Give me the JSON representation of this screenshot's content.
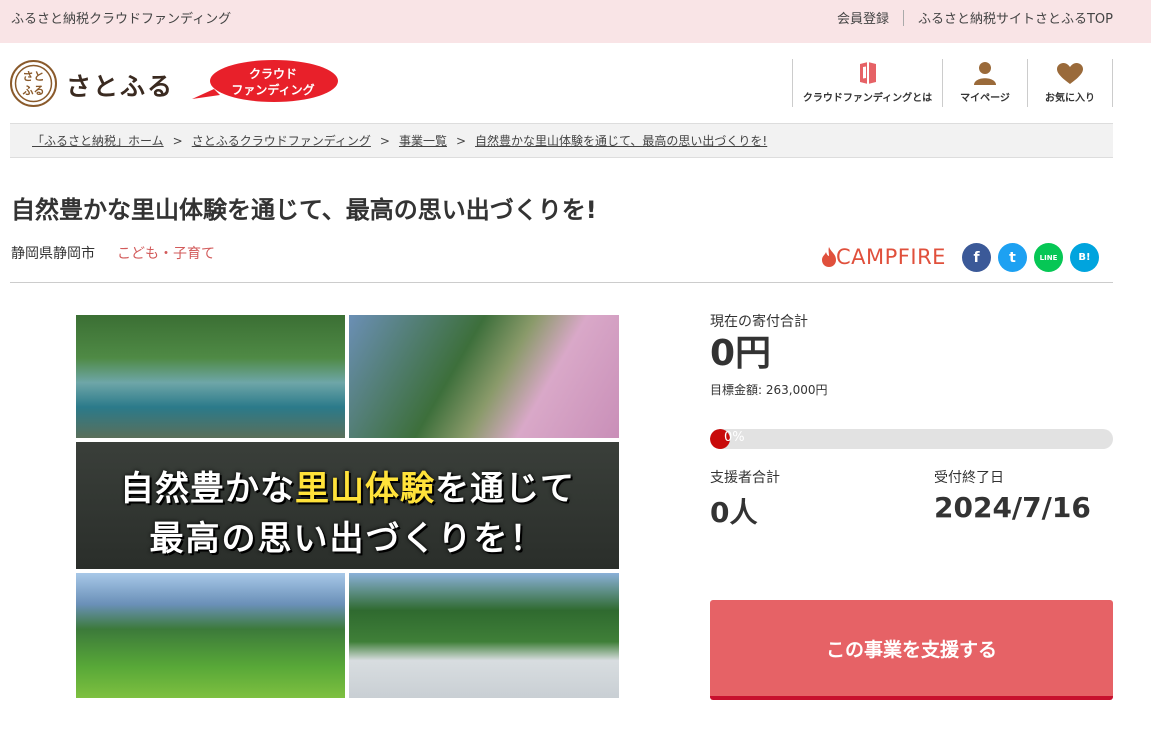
{
  "topbar": {
    "site_name": "ふるさと納税クラウドファンディング",
    "register": "会員登録",
    "satofull_top": "ふるさと納税サイトさとふるTOP"
  },
  "header": {
    "logo_mark": "さとふる",
    "logo_text": "さとふる",
    "badge_line1": "クラウド",
    "badge_line2": "ファンディング",
    "nav": [
      {
        "label": "クラウドファンディングとは",
        "icon": "book-icon"
      },
      {
        "label": "マイページ",
        "icon": "user-icon"
      },
      {
        "label": "お気に入り",
        "icon": "heart-icon"
      }
    ]
  },
  "breadcrumb": [
    "「ふるさと納税」ホーム",
    "さとふるクラウドファンディング",
    "事業一覧",
    "自然豊かな里山体験を通じて、最高の思い出づくりを!"
  ],
  "breadcrumb_sep": ">",
  "project": {
    "title": "自然豊かな里山体験を通じて、最高の思い出づくりを!",
    "location": "静岡県静岡市",
    "category": "こども・子育て",
    "partner": "CAMPFIRE"
  },
  "social": {
    "facebook": "f",
    "twitter": "t",
    "line": "LINE",
    "hatena": "B!"
  },
  "hero": {
    "line1_a": "自然豊かな",
    "line1_hl": "里山体験",
    "line1_b": "を通じて",
    "line2": "最高の思い出づくりを！"
  },
  "funding": {
    "total_label": "現在の寄付合計",
    "total_value": "0円",
    "goal_label": "目標金額:",
    "goal_value": "263,000円",
    "progress_text": "0%",
    "progress_fraction": 0.0,
    "supporters_label": "支援者合計",
    "supporters_value": "0人",
    "deadline_label": "受付終了日",
    "deadline_value": "2024/7/16"
  },
  "cta": {
    "support_label": "この事業を支援する"
  },
  "colors": {
    "topbar_bg": "#f9e4e6",
    "accent_red": "#e66266",
    "category_red": "#d25a5a",
    "campfire": "#e0503c"
  }
}
